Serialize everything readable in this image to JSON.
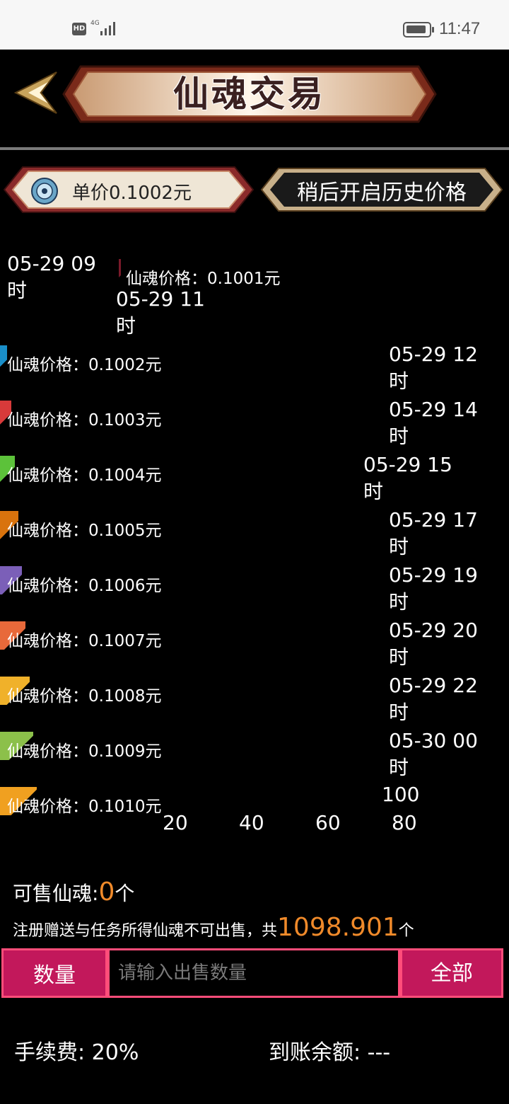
{
  "status": {
    "hd_badge": "HD",
    "network": "4G",
    "time": "11:47"
  },
  "header": {
    "title": "仙魂交易",
    "back_icon": "back-arrow-icon"
  },
  "price": {
    "unit_price": "单价0.1002元",
    "history_button": "稍后开启历史价格",
    "icon": "soul-coin-icon"
  },
  "chart_data": {
    "type": "bar",
    "orientation": "horizontal",
    "series_label_prefix": "仙魂价格：",
    "categories": [
      "05-29 09\n时",
      "05-29 11\n时",
      "05-29 12\n时",
      "05-29 14\n时",
      "05-29 15\n时",
      "05-29 17\n时",
      "05-29 19\n时",
      "05-29 20\n时",
      "05-29 22\n时",
      "05-30 00\n时",
      "100"
    ],
    "rows": [
      {
        "price": "0.1001元",
        "value": 0.5,
        "color": "#7a1a2a",
        "date": "05-29 09 时"
      },
      {
        "price": "0.1002元",
        "value": 2,
        "color": "#1a8fc9",
        "date": "05-29 11 时"
      },
      {
        "price": "0.1003元",
        "value": 3,
        "color": "#d83a3a",
        "date": "05-29 12 时"
      },
      {
        "price": "0.1004元",
        "value": 4,
        "color": "#5cc23a",
        "date": "05-29 14 时"
      },
      {
        "price": "0.1005元",
        "value": 5,
        "color": "#d9730d",
        "date": "05-29 15 时"
      },
      {
        "price": "0.1006元",
        "value": 6,
        "color": "#7b5fb8",
        "date": "05-29 17 时"
      },
      {
        "price": "0.1007元",
        "value": 7,
        "color": "#e8693a",
        "date": "05-29 19 时"
      },
      {
        "price": "0.1008元",
        "value": 8,
        "color": "#f0b12a",
        "date": "05-29 20 时"
      },
      {
        "price": "0.1009元",
        "value": 9,
        "color": "#8cc04a",
        "date": "05-29 22 时"
      },
      {
        "price": "0.1010元",
        "value": 10,
        "color": "#f0a020",
        "date": "05-30 00 时"
      }
    ],
    "x_ticks": [
      "20",
      "40",
      "60",
      "80",
      "100"
    ]
  },
  "sell": {
    "available_label": "可售仙魂:",
    "available_value": "0",
    "available_unit": "个",
    "note_text": "注册赠送与任务所得仙魂不可出售，共",
    "note_value": "1098.901",
    "note_unit": "个"
  },
  "quantity": {
    "label": "数量",
    "placeholder": "请输入出售数量",
    "value": "",
    "all_button": "全部"
  },
  "footer": {
    "fee": "手续费: 20%",
    "balance": "到账余额: ---"
  }
}
